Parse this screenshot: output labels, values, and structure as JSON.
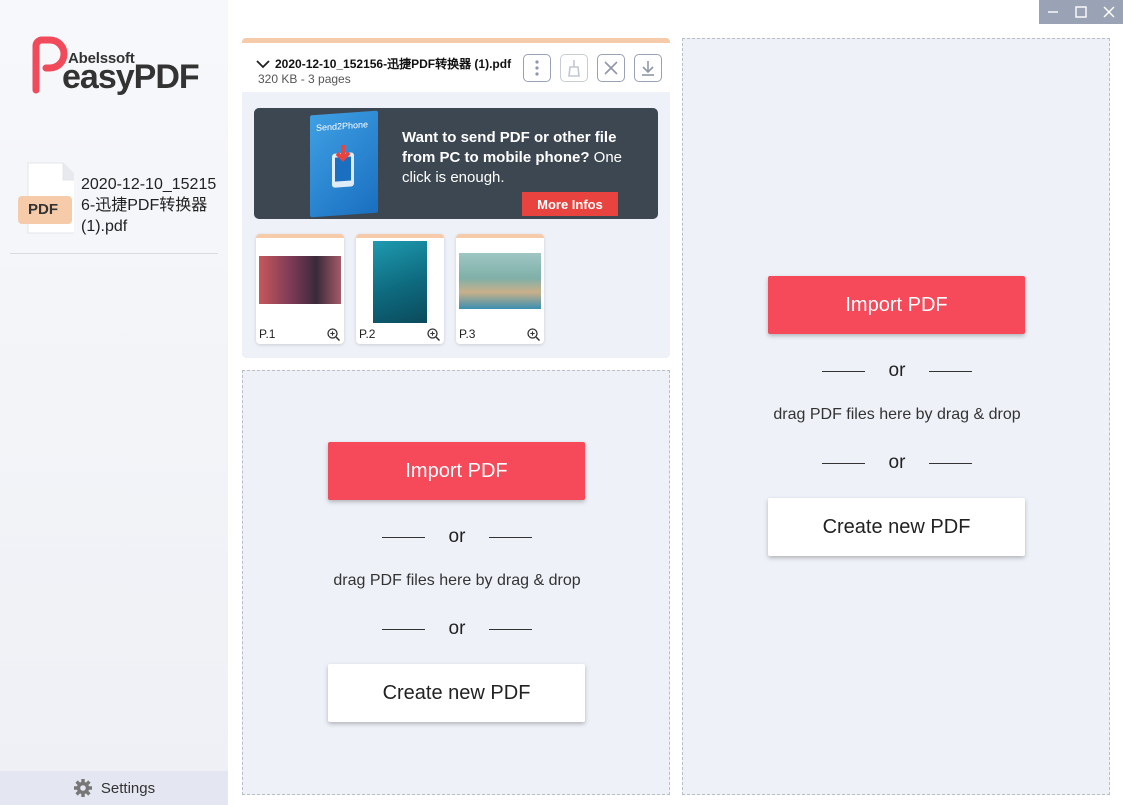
{
  "window": {
    "controls": [
      "minimize-icon",
      "maximize-icon",
      "close-icon"
    ]
  },
  "sidebar": {
    "logo_small": "Abelssoft",
    "logo_big": "easyPDF",
    "file": {
      "icon_label": "PDF",
      "name": "2020-12-10_152156-迅捷PDF转换器 (1).pdf"
    },
    "settings_label": "Settings"
  },
  "pdf_card": {
    "title": "2020-12-10_152156-迅捷PDF转换器 (1).pdf",
    "subtitle": "320 KB - 3 pages",
    "ad": {
      "product": "Send2Phone",
      "headline": "Want to send PDF or other file from PC to mobile phone?",
      "tail": "One click is enough.",
      "button": "More Infos"
    },
    "pages": [
      {
        "label": "P.1"
      },
      {
        "label": "P.2"
      },
      {
        "label": "P.3"
      }
    ]
  },
  "drop_zone": {
    "import_label": "Import PDF",
    "or_label": "or",
    "drag_text": "drag PDF files here by drag & drop",
    "create_label": "Create new PDF"
  },
  "colors": {
    "accent": "#f6495a",
    "tab_accent": "#f6cba9",
    "panel_bg": "#eef1f8"
  }
}
